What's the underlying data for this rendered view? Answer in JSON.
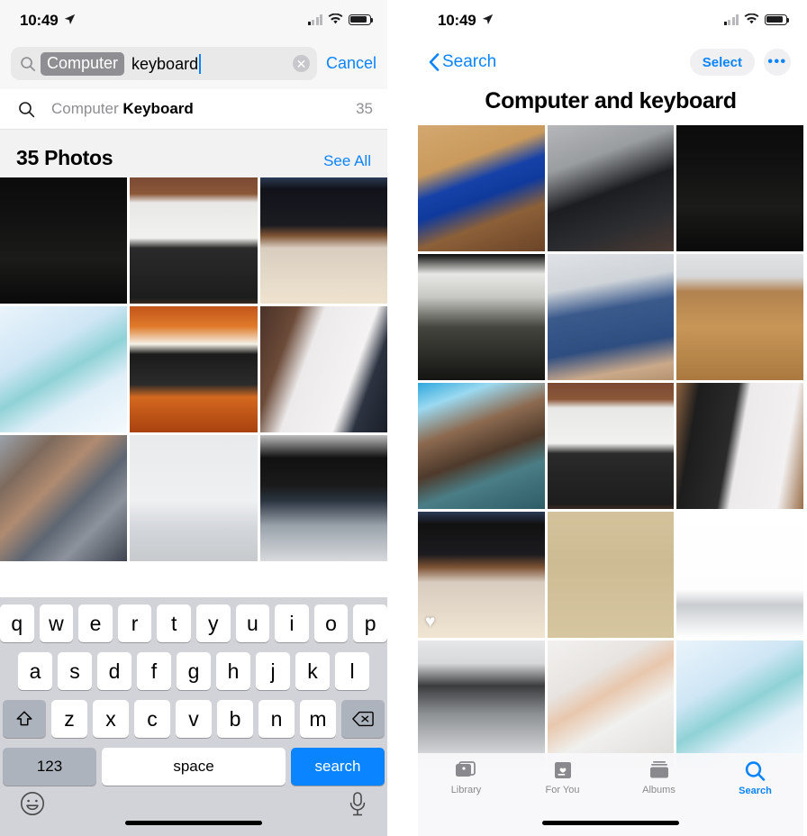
{
  "left": {
    "status_bar": {
      "time": "10:49",
      "location_icon": "location-arrow-icon",
      "wifi_icon": "wifi-icon",
      "cellular_icon": "cellular-bars-icon",
      "battery_icon": "battery-icon"
    },
    "search": {
      "search_icon": "search-icon",
      "token": "Computer",
      "query": "keyboard",
      "clear_icon": "clear-circle-icon",
      "cancel_label": "Cancel"
    },
    "suggestion": {
      "icon": "search-icon",
      "prefix": "Computer ",
      "bold": "Keyboard",
      "count": "35"
    },
    "photos_header": {
      "title": "35 Photos",
      "see_all": "See All"
    },
    "grid": {
      "rows": 3,
      "columns": 3,
      "cells": [
        {
          "name": "photo-bw-person-at-imac",
          "alt": "Black and white photo of person at iMac desk"
        },
        {
          "name": "photo-two-keyboards-on-desk",
          "alt": "White and black keyboards on wood desk"
        },
        {
          "name": "photo-laptop-keyboard-closeup",
          "alt": "MacBook keyboard close-up with strap"
        },
        {
          "name": "photo-hands-typing-bright",
          "alt": "Hands typing on bright laptop"
        },
        {
          "name": "photo-colorful-monitor-orange",
          "alt": "Colorful monitor with orange light panels"
        },
        {
          "name": "photo-samsung-device-in-hand",
          "alt": "Samsung device held in hand near laptop"
        },
        {
          "name": "photo-blurred-pixelated",
          "alt": "Pixelated blurred photo"
        },
        {
          "name": "photo-imac-desk-wall-art",
          "alt": "iMac on desk with framed wall art"
        },
        {
          "name": "photo-macbook-touch-bar",
          "alt": "MacBook Touch Bar close-up"
        }
      ]
    },
    "keyboard": {
      "row1": [
        "q",
        "w",
        "e",
        "r",
        "t",
        "y",
        "u",
        "i",
        "o",
        "p"
      ],
      "row2": [
        "a",
        "s",
        "d",
        "f",
        "g",
        "h",
        "j",
        "k",
        "l"
      ],
      "row3": [
        "z",
        "x",
        "c",
        "v",
        "b",
        "n",
        "m"
      ],
      "shift_icon": "shift-arrow-icon",
      "backspace_icon": "backspace-icon",
      "numbers_label": "123",
      "space_label": "space",
      "return_label": "search",
      "emoji_icon": "emoji-smiley-icon",
      "dictation_icon": "microphone-icon"
    }
  },
  "right": {
    "status_bar": {
      "time": "10:49",
      "location_icon": "location-arrow-icon"
    },
    "nav": {
      "back_icon": "chevron-left-icon",
      "back_label": "Search",
      "select_label": "Select",
      "more_label": "•••"
    },
    "title": "Computer and  keyboard",
    "grid": {
      "rows": 5,
      "columns": 3,
      "cells": [
        {
          "name": "photo-child-at-crt-monitor",
          "alt": "Child at desk with blue-screen CRT monitor"
        },
        {
          "name": "photo-child-typing-dark-room",
          "alt": "Child with hair clip typing in dark room"
        },
        {
          "name": "photo-bw-person-at-imac",
          "alt": "Black and white photo of person at iMac"
        },
        {
          "name": "photo-bw-child-at-imac-office",
          "alt": "Black and white child at iMac in office"
        },
        {
          "name": "photo-man-blue-shirt-smiling",
          "alt": "Smiling man in blue shirt at computer"
        },
        {
          "name": "photo-imac-desk-flatlay",
          "alt": "iMac keyboard mouse tablet flat lay on wood desk"
        },
        {
          "name": "photo-child-in-pajamas-imac",
          "alt": "Child in star pajamas at iMac"
        },
        {
          "name": "photo-two-keyboards-on-desk",
          "alt": "White and black keyboards on wood desk"
        },
        {
          "name": "photo-black-white-keyboards-wood",
          "alt": "Black and white keyboards side by side"
        },
        {
          "name": "photo-macbook-keyboard-strap",
          "alt": "MacBook keyboard with strap, favorited",
          "hearted": true
        },
        {
          "name": "photo-illustration-desk-education",
          "alt": "Isometric illustration of computer and books"
        },
        {
          "name": "photo-imac-blank-screen",
          "alt": "iMac with blank white screen"
        },
        {
          "name": "photo-bw-imac-keyboard-mouse",
          "alt": "Black and white iMac keyboard and magic mouse"
        },
        {
          "name": "photo-finger-pressing-key",
          "alt": "Finger pressing key on white keyboard"
        },
        {
          "name": "photo-hands-typing-bright",
          "alt": "Hands typing on keyboard, bright window"
        }
      ]
    },
    "tabs": [
      {
        "label": "Library",
        "icon": "photos-library-icon",
        "active": false
      },
      {
        "label": "For You",
        "icon": "for-you-heart-icon",
        "active": false
      },
      {
        "label": "Albums",
        "icon": "albums-stack-icon",
        "active": false
      },
      {
        "label": "Search",
        "icon": "search-icon",
        "active": true
      }
    ]
  },
  "colors": {
    "accent": "#0a84ff",
    "token_bg": "#8e8e93",
    "search_field_bg": "#e9e9ea",
    "keyboard_bg": "#d1d3d9",
    "key_special_bg": "#adb3bd",
    "secondary_text": "#8e8e93"
  }
}
